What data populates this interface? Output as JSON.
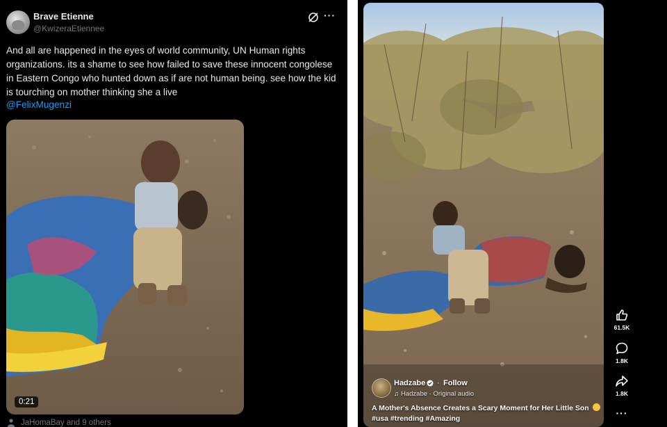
{
  "post": {
    "display_name": "Brave Etienne",
    "handle": "@KwizeraEtiennee",
    "text": "And all are happened in the eyes of world community, UN Human rights organizations. its a shame to see how failed to save these innocent congolese in Eastern Congo who hunted down as if are not human being. see  how the kid is tourching on mother thinking she a live",
    "mention": "@FelixMugenzi",
    "video_time": "0:21",
    "liked_by": "JaHomaBay and 9 others",
    "more_label": "···",
    "icons": {
      "avatar": "profile-avatar",
      "grok": "grok-icon",
      "more": "more-icon",
      "liked_by": "person-icon"
    }
  },
  "reel": {
    "creator_name": "Hadzabe",
    "follow_separator": "·",
    "follow_label": "Follow",
    "audio": "Hadzabe · Original audio",
    "caption": "A Mother's Absence Creates a Scary Moment for Her Little Son",
    "hashtags": [
      "#usa",
      "#trending",
      "#Amazing"
    ],
    "likes": "61.5K",
    "comments": "1.8K",
    "shares": "1.8K",
    "more_label": "···",
    "icons": {
      "like": "thumbs-up-icon",
      "comment": "comment-icon",
      "share": "share-icon",
      "verified": "verified-icon",
      "music": "music-icon"
    }
  },
  "colors": {
    "background": "#000000",
    "link": "#1d9bf0",
    "muted_text": "#71767b",
    "primary_text": "#e7e9ea",
    "divider": "#ffffff"
  }
}
